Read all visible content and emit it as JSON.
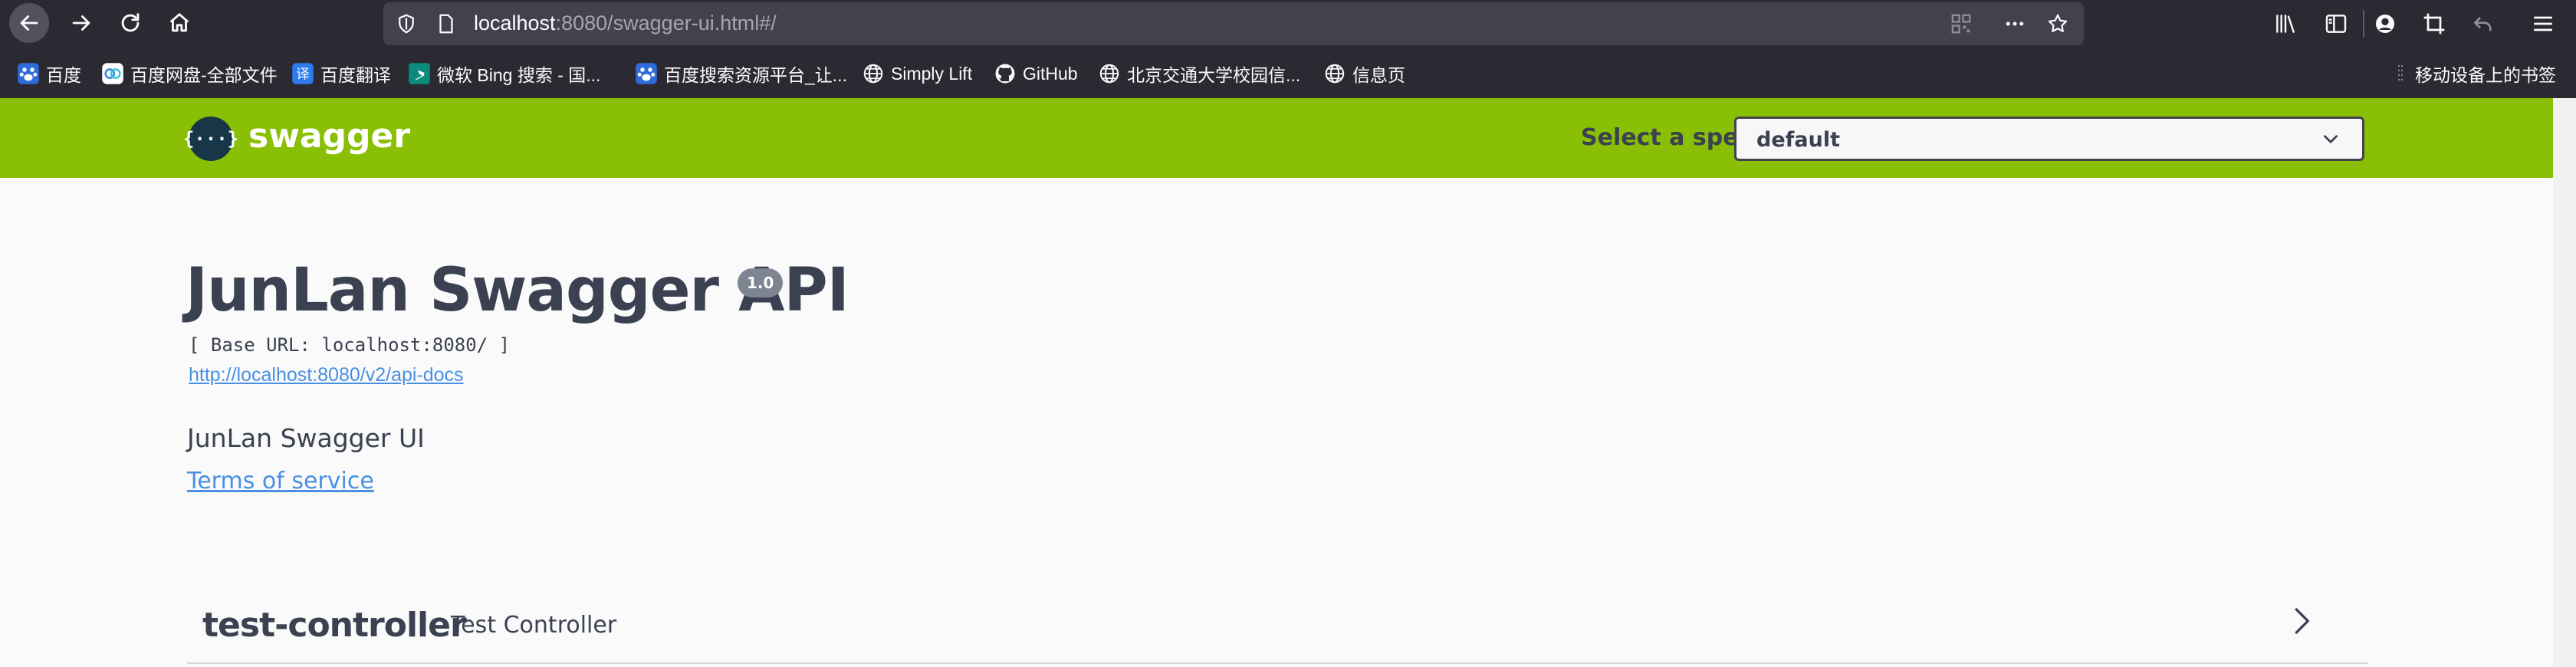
{
  "browser": {
    "url_host": "localhost",
    "url_rest": ":8080/swagger-ui.html#/",
    "icons": {
      "back": "back-arrow-icon",
      "forward": "forward-arrow-icon",
      "reload": "reload-icon",
      "home": "home-icon"
    }
  },
  "bookmarks": {
    "items": [
      {
        "label": "百度",
        "icon": "baidu-paw-icon"
      },
      {
        "label": "百度网盘-全部文件",
        "icon": "baidu-cloud-icon"
      },
      {
        "label": "百度翻译",
        "icon": "baidu-translate-icon"
      },
      {
        "label": "微软 Bing 搜索 - 国...",
        "icon": "bing-icon"
      },
      {
        "label": "百度搜索资源平台_让...",
        "icon": "baidu-paw-icon"
      },
      {
        "label": "Simply Lift",
        "icon": "globe-icon"
      },
      {
        "label": "GitHub",
        "icon": "github-icon"
      },
      {
        "label": "北京交通大学校园信...",
        "icon": "globe-icon"
      },
      {
        "label": "信息页",
        "icon": "globe-icon"
      }
    ],
    "mobile": "移动设备上的书签"
  },
  "swagger_bar": {
    "brand": "swagger",
    "logo_glyph": "{···}",
    "select_label": "Select a spec",
    "select_value": "default",
    "colors": {
      "bar": "#89bf04",
      "logo_bg": "#173647"
    }
  },
  "info": {
    "title": "JunLan Swagger API",
    "version": "1.0",
    "base_url": "[ Base URL: localhost:8080/ ]",
    "docs_link": "http://localhost:8080/v2/api-docs",
    "description": "JunLan Swagger UI",
    "terms": "Terms of service"
  },
  "tags": [
    {
      "name": "test-controller",
      "description": "Test Controller"
    }
  ]
}
